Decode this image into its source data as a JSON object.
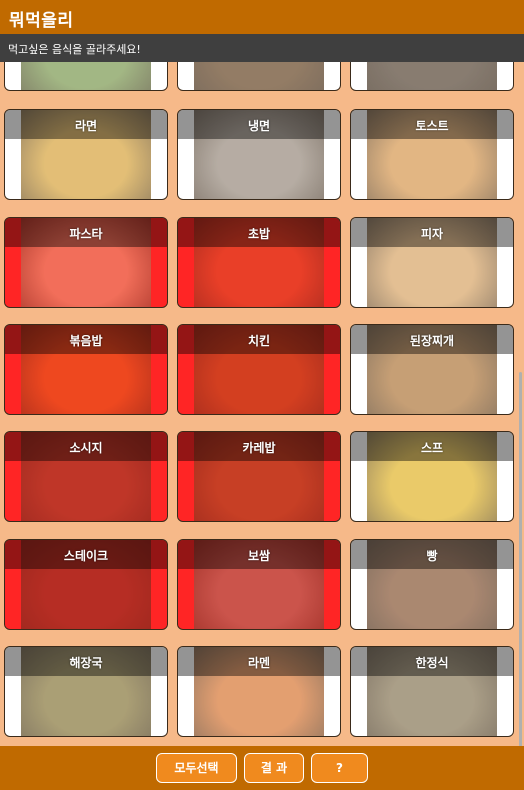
{
  "app": {
    "title": "뭐먹을리"
  },
  "prompt": {
    "text": "먹고싶은 음식을 골라주세요!"
  },
  "colors": {
    "appbar": "#c06a00",
    "subbar": "#3f3f3f",
    "background": "#f6b989",
    "selected": "#ff2a2a",
    "button": "#f08a1e"
  },
  "foods": [
    {
      "label": "",
      "selected": false,
      "tone": "#7f9b55"
    },
    {
      "label": "",
      "selected": false,
      "tone": "#6a4a2a"
    },
    {
      "label": "",
      "selected": false,
      "tone": "#5a4a3a"
    },
    {
      "label": "라면",
      "selected": false,
      "tone": "#d8a642"
    },
    {
      "label": "냉면",
      "selected": false,
      "tone": "#9a8d80"
    },
    {
      "label": "토스트",
      "selected": false,
      "tone": "#d79a54"
    },
    {
      "label": "파스타",
      "selected": true,
      "tone": "#e7b08a"
    },
    {
      "label": "초밥",
      "selected": true,
      "tone": "#d85a30"
    },
    {
      "label": "피자",
      "selected": false,
      "tone": "#d9a76a"
    },
    {
      "label": "볶음밥",
      "selected": true,
      "tone": "#e06a20"
    },
    {
      "label": "치킨",
      "selected": true,
      "tone": "#b05a22"
    },
    {
      "label": "된장찌개",
      "selected": false,
      "tone": "#b07a40"
    },
    {
      "label": "소시지",
      "selected": true,
      "tone": "#8a4a30"
    },
    {
      "label": "카레밥",
      "selected": true,
      "tone": "#9a5a2a"
    },
    {
      "label": "스프",
      "selected": false,
      "tone": "#e2b630"
    },
    {
      "label": "스테이크",
      "selected": true,
      "tone": "#7a3a28"
    },
    {
      "label": "보쌈",
      "selected": true,
      "tone": "#a08070"
    },
    {
      "label": "빵",
      "selected": false,
      "tone": "#8a5a3a"
    },
    {
      "label": "해장국",
      "selected": false,
      "tone": "#8a7a40"
    },
    {
      "label": "라멘",
      "selected": false,
      "tone": "#d87a3a"
    },
    {
      "label": "한정식",
      "selected": false,
      "tone": "#8a7a5a"
    }
  ],
  "buttons": {
    "select_all": "모두선택",
    "result": "결 과",
    "help": "?"
  }
}
